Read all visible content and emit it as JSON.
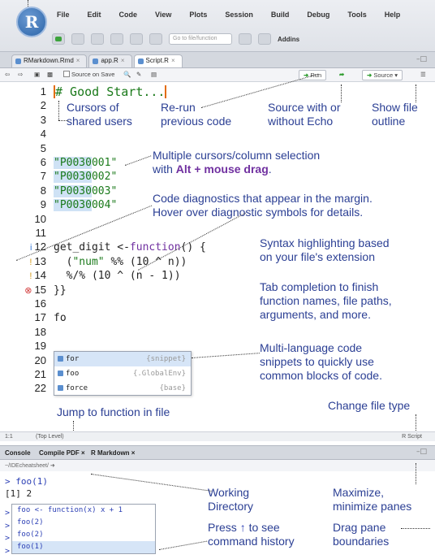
{
  "app": {
    "logo_letter": "R",
    "menu": [
      "File",
      "Edit",
      "Code",
      "View",
      "Plots",
      "Session",
      "Build",
      "Debug",
      "Tools",
      "Help"
    ],
    "goto_placeholder": "Go to file/function",
    "addins_label": "Addins"
  },
  "editor_tabs": [
    {
      "label": "RMarkdown.Rmd"
    },
    {
      "label": "app.R"
    },
    {
      "label": "Script.R"
    }
  ],
  "editor_toolbar": {
    "source_on_save": "Source on Save",
    "run_label": "Run",
    "source_label": "Source"
  },
  "editor": {
    "lines": [
      {
        "num": "1",
        "code": "# Good Start..."
      },
      {
        "num": "2",
        "code": ""
      },
      {
        "num": "3",
        "code": ""
      },
      {
        "num": "4",
        "code": ""
      },
      {
        "num": "5",
        "code": ""
      },
      {
        "num": "6",
        "code": "\"P0030001\""
      },
      {
        "num": "7",
        "code": "\"P0030002\""
      },
      {
        "num": "8",
        "code": "\"P0030003\""
      },
      {
        "num": "9",
        "code": "\"P0030004\""
      },
      {
        "num": "10",
        "code": ""
      },
      {
        "num": "11",
        "code": ""
      },
      {
        "num": "12",
        "code": "get_digit <-function() {"
      },
      {
        "num": "13",
        "code": "  (\"num\" %% (10 ^ n))"
      },
      {
        "num": "14",
        "code": "  %/% (10 ^ (n - 1))"
      },
      {
        "num": "15",
        "code": "}}"
      },
      {
        "num": "16",
        "code": ""
      },
      {
        "num": "17",
        "code": "fo"
      },
      {
        "num": "18",
        "code": ""
      },
      {
        "num": "19",
        "code": ""
      },
      {
        "num": "20",
        "code": ""
      },
      {
        "num": "21",
        "code": ""
      },
      {
        "num": "22",
        "code": ""
      }
    ],
    "autocomplete": [
      {
        "name": "for",
        "env": "{snippet}"
      },
      {
        "name": "foo",
        "env": "{.GlobalEnv}"
      },
      {
        "name": "force",
        "env": "{base}"
      }
    ],
    "status_position": "1:1",
    "status_scope": "(Top Level)",
    "status_filetype": "R Script"
  },
  "annotations": {
    "cursors": "Cursors of\nshared users",
    "rerun": "Re-run\nprevious code",
    "source_echo": "Source with or\nwithout Echo",
    "outline": "Show file\noutline",
    "multi_cursor_1": "Multiple cursors/column selection",
    "multi_cursor_2_pre": "with ",
    "multi_cursor_2_bold": "Alt + mouse drag",
    "multi_cursor_2_post": ".",
    "diagnostics": "Code diagnostics that appear in the margin.\nHover over diagnostic symbols for details.",
    "syntax": "Syntax highlighting based\non your file's extension",
    "tab_completion": "Tab completion to finish\nfunction names, file paths,\narguments, and more.",
    "snippets": "Multi-language code\nsnippets to quickly use\ncommon blocks of code.",
    "jump": "Jump to function in file",
    "filetype": "Change file type",
    "wd": "Working\nDirectory",
    "maximize": "Maximize,\nminimize panes",
    "history_pre": "Press ",
    "history_arrow": "↑",
    "history_post": " to see\ncommand history",
    "drag": "Drag pane\nboundaries"
  },
  "console": {
    "tabs": [
      "Console",
      "Compile PDF",
      "R Markdown"
    ],
    "path": "~/IDEcheatsheet/",
    "lines": [
      "> foo(1)",
      "[1] 2"
    ],
    "history": [
      "foo <- function(x) x + 1",
      "foo(2)",
      "foo(2)",
      "foo(1)"
    ]
  }
}
